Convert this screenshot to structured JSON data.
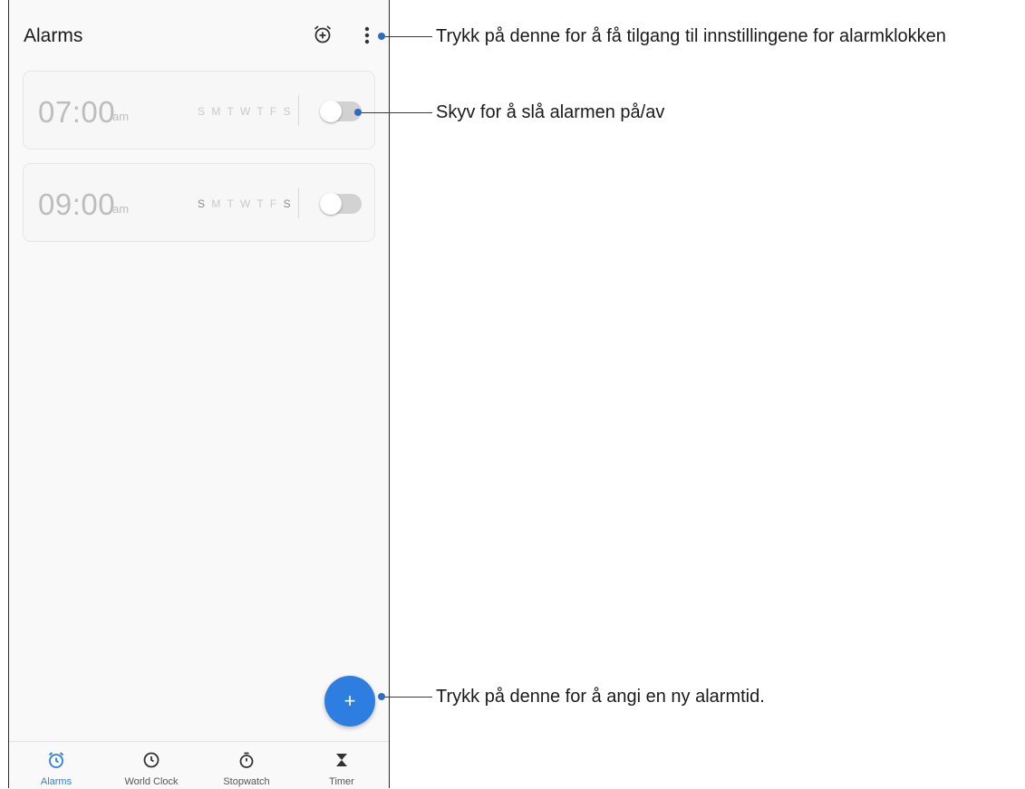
{
  "app": {
    "title": "Alarms"
  },
  "header": {
    "add_alarm_icon": "alarm-add-icon",
    "more_icon": "more-vertical-icon"
  },
  "alarms": [
    {
      "time": "07:00",
      "ampm": "am",
      "days": [
        "S",
        "M",
        "T",
        "W",
        "T",
        "F",
        "S"
      ],
      "active_days": [
        false,
        false,
        false,
        false,
        false,
        false,
        false
      ],
      "enabled": false
    },
    {
      "time": "09:00",
      "ampm": "am",
      "days": [
        "S",
        "M",
        "T",
        "W",
        "T",
        "F",
        "S"
      ],
      "active_days": [
        true,
        false,
        false,
        false,
        false,
        false,
        true
      ],
      "enabled": false
    }
  ],
  "fab": {
    "label": "+"
  },
  "bottom_nav": [
    {
      "label": "Alarms",
      "icon": "alarm-clock-icon",
      "active": true
    },
    {
      "label": "World Clock",
      "icon": "clock-icon",
      "active": false
    },
    {
      "label": "Stopwatch",
      "icon": "stopwatch-icon",
      "active": false
    },
    {
      "label": "Timer",
      "icon": "hourglass-icon",
      "active": false
    }
  ],
  "callouts": {
    "settings": "Trykk på denne for å få tilgang til innstillingene for alarmklokken",
    "toggle": "Skyv for å slå alarmen på/av",
    "add": "Trykk på denne for å angi en ny alarmtid."
  },
  "colors": {
    "accent": "#2e7de0",
    "dot": "#2b6cc4",
    "disabled_text": "#bdbdbd"
  }
}
